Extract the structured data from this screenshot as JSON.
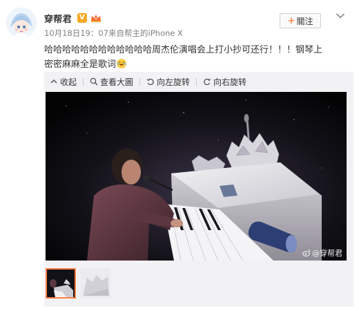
{
  "header": {
    "name": "穿帮君",
    "vip_label": "V",
    "follow_label": "關注",
    "follow_plus": "+",
    "timestamp": "10月18日19：07",
    "source_prefix": " 来自",
    "source": "帮主的iPhone X"
  },
  "post": {
    "text": "哈哈哈哈哈哈哈哈哈哈哈哈周杰伦演唱会上打小抄可还行！！！钢琴上密密麻麻全是歌词"
  },
  "toolbar": {
    "collapse": "收起",
    "view_large": "查看大圖",
    "rotate_left": "向左旋转",
    "rotate_right": "向右旋转"
  },
  "photo": {
    "watermark": "@穿帮君"
  },
  "colors": {
    "accent": "#ff8140",
    "vip": "#f7a823",
    "text": "#333333",
    "meta": "#808080",
    "media_bg": "#f2f2f5"
  }
}
